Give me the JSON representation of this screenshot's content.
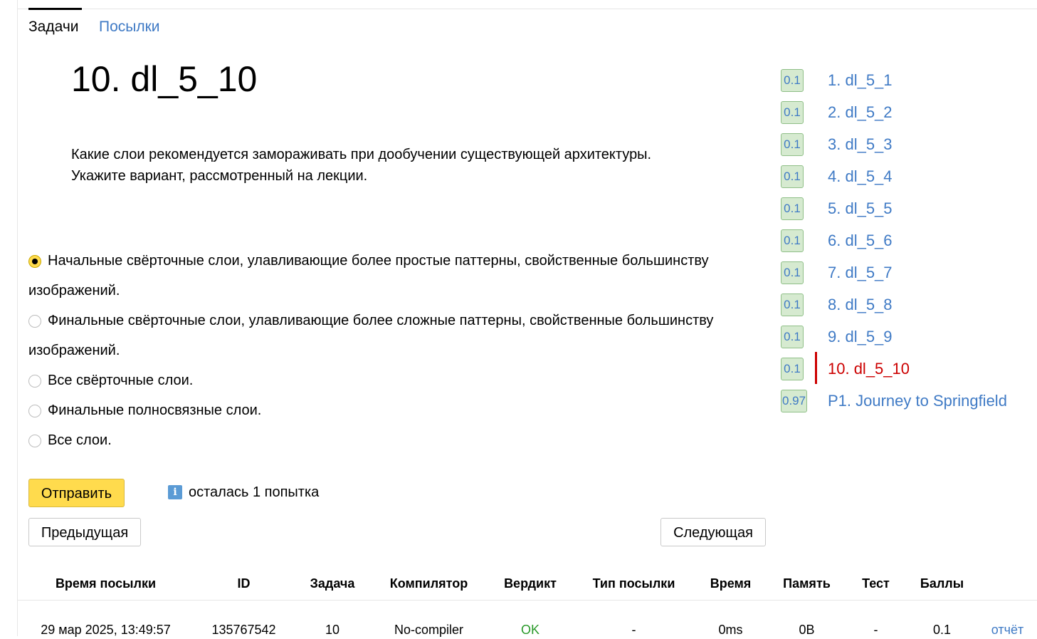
{
  "tabs": {
    "problems": "Задачи",
    "submissions": "Посылки"
  },
  "problem": {
    "title": "10. dl_5_10",
    "statement_line1": "Какие слои рекомендуется замораживать при дообучении существующей архитектуры.",
    "statement_line2": "Укажите вариант, рассмотренный на лекции."
  },
  "options": [
    {
      "line1": "Начальные свёрточные слои, улавливающие более простые паттерны, свойственные большинству",
      "line2": "изображений.",
      "checked": true
    },
    {
      "line1": "Финальные свёрточные слои, улавливающие более сложные паттерны, свойственные большинству",
      "line2": "изображений.",
      "checked": false
    },
    {
      "line1": "Все свёрточные слои.",
      "checked": false
    },
    {
      "line1": "Финальные полносвязные слои.",
      "checked": false
    },
    {
      "line1": "Все слои.",
      "checked": false
    }
  ],
  "actions": {
    "submit": "Отправить",
    "attempts_left": "осталась 1 попытка",
    "info_icon": "i",
    "prev": "Предыдущая",
    "next": "Следующая"
  },
  "problem_list": [
    {
      "score": "0.1",
      "label": "1. dl_5_1"
    },
    {
      "score": "0.1",
      "label": "2. dl_5_2"
    },
    {
      "score": "0.1",
      "label": "3. dl_5_3"
    },
    {
      "score": "0.1",
      "label": "4. dl_5_4"
    },
    {
      "score": "0.1",
      "label": "5. dl_5_5"
    },
    {
      "score": "0.1",
      "label": "6. dl_5_6"
    },
    {
      "score": "0.1",
      "label": "7. dl_5_7"
    },
    {
      "score": "0.1",
      "label": "8. dl_5_8"
    },
    {
      "score": "0.1",
      "label": "9. dl_5_9"
    },
    {
      "score": "0.1",
      "label": "10. dl_5_10",
      "current": true
    },
    {
      "score": "0.97",
      "label": "P1. Journey to Springfield"
    }
  ],
  "submissions_table": {
    "headers": [
      "Время посылки",
      "ID",
      "Задача",
      "Компилятор",
      "Вердикт",
      "Тип посылки",
      "Время",
      "Память",
      "Тест",
      "Баллы",
      ""
    ],
    "rows": [
      [
        "29 мар 2025, 13:49:57",
        "135767542",
        "10",
        "No-compiler",
        "OK",
        "-",
        "0ms",
        "0B",
        "-",
        "0.1",
        "отчёт"
      ]
    ]
  },
  "colors": {
    "accent_link": "#3f7ac5",
    "current": "#cc0000",
    "submit": "#ffdb4d",
    "ok": "#2a9a2a",
    "badge_bg": "#d6ead0"
  }
}
